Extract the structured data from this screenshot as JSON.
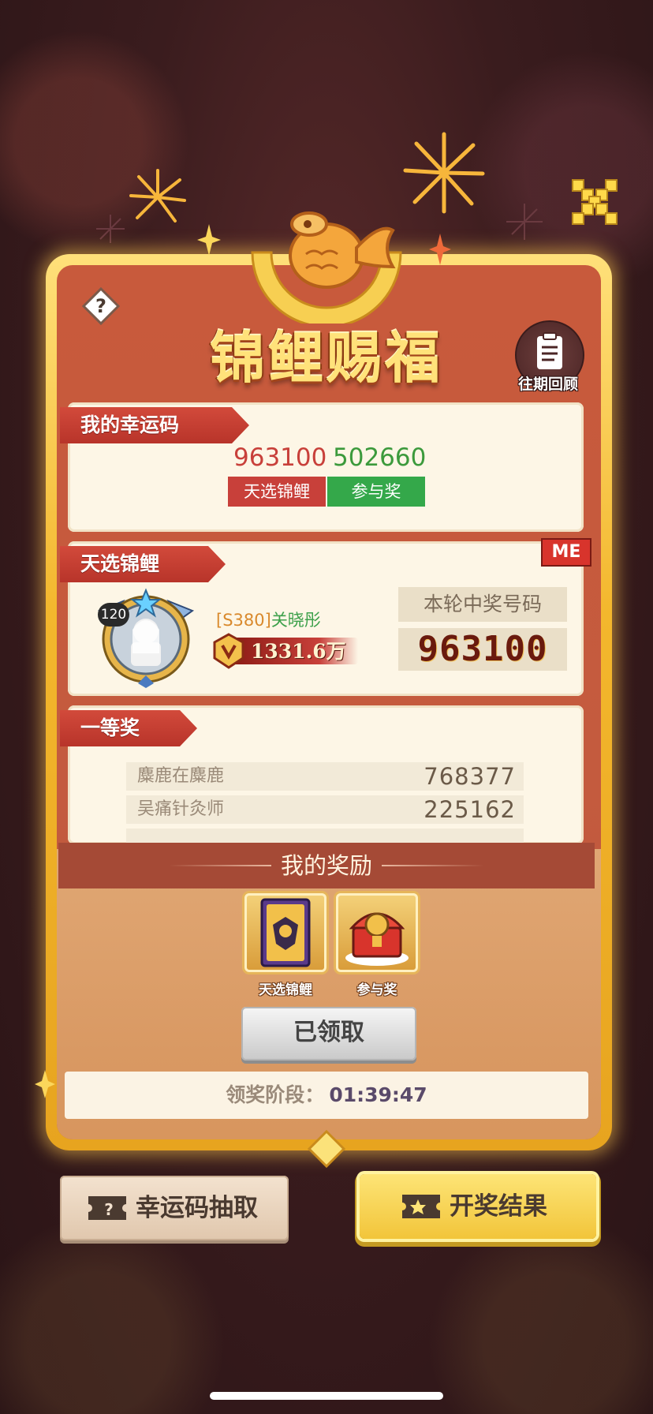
{
  "title": "锦鲤赐福",
  "history": {
    "label": "往期回顾",
    "icon": "clipboard-icon"
  },
  "help": {
    "icon": "question-icon"
  },
  "close": {
    "icon": "close-icon"
  },
  "my_codes": {
    "section_title": "我的幸运码",
    "codes": [
      {
        "number": "963100",
        "tag": "天选锦鲤",
        "number_color": "#c8403a",
        "tag_color": "#c8403a"
      },
      {
        "number": "502660",
        "tag": "参与奖",
        "number_color": "#3c9a3c",
        "tag_color": "#34a84a"
      }
    ]
  },
  "chosen": {
    "section_title": "天选锦鲤",
    "me_badge": "ME",
    "level": "120",
    "server": "[S380]",
    "player_name": "关晓彤",
    "power": "1331.6万",
    "winning_label": "本轮中奖号码",
    "winning_number": "963100"
  },
  "first_prize": {
    "section_title": "一等奖",
    "rows": [
      {
        "name": "麋鹿在麋鹿",
        "code": "768377"
      },
      {
        "name": "吴痛针灸师",
        "code": "225162"
      }
    ]
  },
  "my_rewards": {
    "title": "我的奖励",
    "items": [
      {
        "label": "天选锦鲤",
        "icon": "koi-card-icon"
      },
      {
        "label": "参与奖",
        "icon": "treasure-chest-icon"
      }
    ]
  },
  "claimed_button": "已领取",
  "stage": {
    "label": "领奖阶段：",
    "time": "01:39:47"
  },
  "buttons": {
    "lucky_draw": "幸运码抽取",
    "results": "开奖结果"
  },
  "colors": {
    "frame_gold": "#f3b72d",
    "panel_red": "#c85a3c",
    "ribbon_red": "#c23d31",
    "cream": "#fdf6e6"
  }
}
